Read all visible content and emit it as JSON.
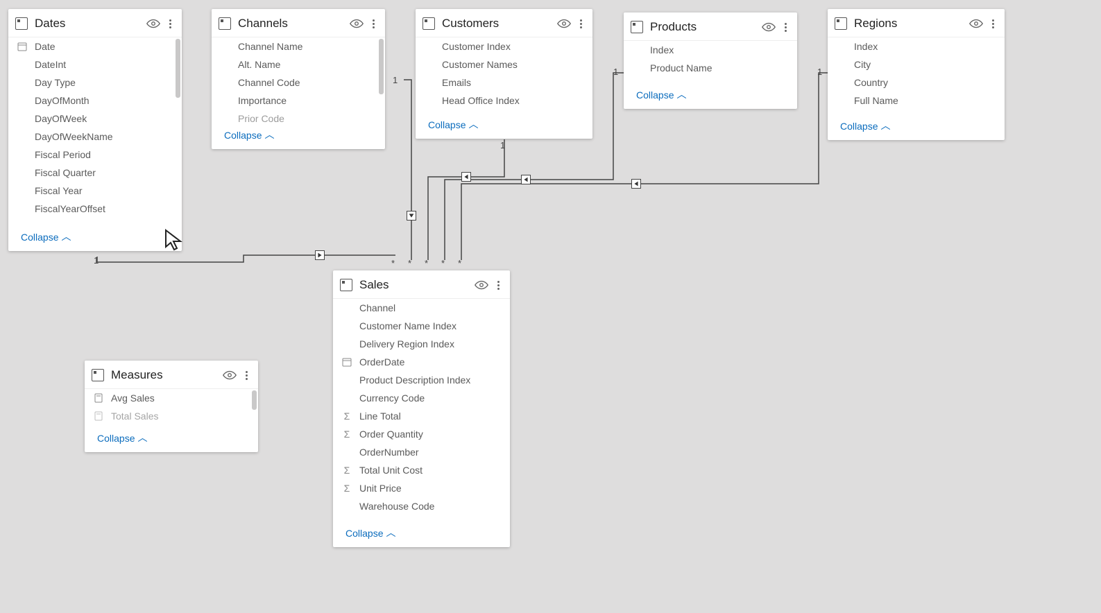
{
  "collapse_label": "Collapse",
  "tables": {
    "dates": {
      "title": "Dates",
      "fields": [
        "Date",
        "DateInt",
        "Day Type",
        "DayOfMonth",
        "DayOfWeek",
        "DayOfWeekName",
        "Fiscal Period",
        "Fiscal Quarter",
        "Fiscal Year",
        "FiscalYearOffset"
      ],
      "icons": [
        "date",
        "",
        "",
        "",
        "",
        "",
        "",
        "",
        "",
        ""
      ]
    },
    "channels": {
      "title": "Channels",
      "fields": [
        "Channel Name",
        "Alt. Name",
        "Channel Code",
        "Importance",
        "Prior Code"
      ],
      "icons": [
        "",
        "",
        "",
        "",
        ""
      ]
    },
    "customers": {
      "title": "Customers",
      "fields": [
        "Customer Index",
        "Customer Names",
        "Emails",
        "Head Office Index"
      ],
      "icons": [
        "",
        "",
        "",
        ""
      ]
    },
    "products": {
      "title": "Products",
      "fields": [
        "Index",
        "Product Name"
      ],
      "icons": [
        "",
        ""
      ]
    },
    "regions": {
      "title": "Regions",
      "fields": [
        "Index",
        "City",
        "Country",
        "Full Name"
      ],
      "icons": [
        "",
        "",
        "",
        ""
      ]
    },
    "sales": {
      "title": "Sales",
      "fields": [
        "Channel",
        "Customer Name Index",
        "Delivery Region Index",
        "OrderDate",
        "Product Description Index",
        "Currency Code",
        "Line Total",
        "Order Quantity",
        "OrderNumber",
        "Total Unit Cost",
        "Unit Price",
        "Warehouse Code"
      ],
      "icons": [
        "",
        "",
        "",
        "date",
        "",
        "",
        "sigma",
        "sigma",
        "",
        "sigma",
        "sigma",
        ""
      ]
    },
    "measures": {
      "title": "Measures",
      "fields": [
        "Avg Sales",
        "Total Sales"
      ],
      "icons": [
        "calc",
        "calc"
      ]
    }
  },
  "relationships": [
    {
      "from": "dates",
      "to": "sales",
      "from_card": "1",
      "to_card": "*"
    },
    {
      "from": "channels",
      "to": "sales",
      "from_card": "1",
      "to_card": "*"
    },
    {
      "from": "customers",
      "to": "sales",
      "from_card": "1",
      "to_card": "*"
    },
    {
      "from": "products",
      "to": "sales",
      "from_card": "1",
      "to_card": "*"
    },
    {
      "from": "regions",
      "to": "sales",
      "from_card": "1",
      "to_card": "*"
    }
  ]
}
